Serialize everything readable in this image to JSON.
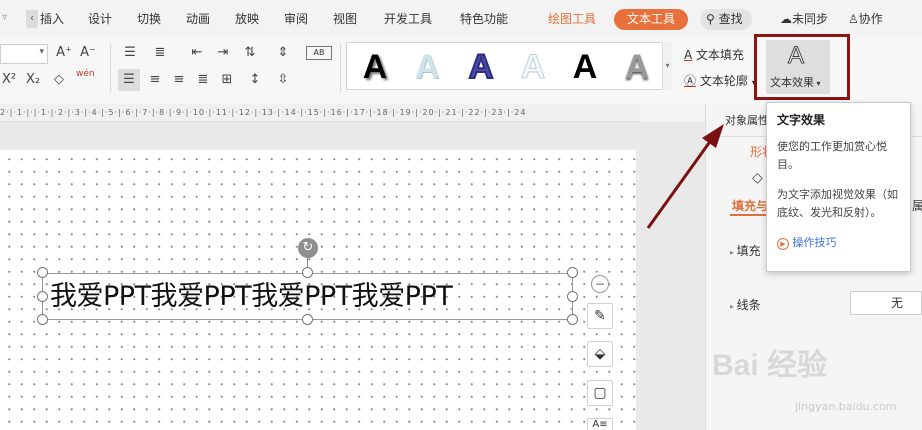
{
  "tabs": {
    "insert": "插入",
    "design": "设计",
    "transition": "切换",
    "animation": "动画",
    "slideshow": "放映",
    "review": "审阅",
    "view": "视图",
    "developer": "开发工具",
    "special": "特色功能",
    "drawing_tools": "绘图工具",
    "text_tools": "文本工具"
  },
  "top_right": {
    "search": "查找",
    "unsync": "未同步",
    "collab": "协作"
  },
  "ribbon": {
    "text_fill": "文本填充",
    "text_outline": "文本轮廓",
    "text_effect": "文本效果",
    "wen_label": "wén",
    "ab_label": "AB",
    "wordart_glyph": "A"
  },
  "ruler_text": "2·|·1·|·|·1·|·2·|·3·|·4·|·5·|·6·|·7·|·8·|·9·|·10·|·11·|·12·|·13·|·14·|·15·|·16·|·17·|·18·|·19·|·20·|·21·|·22·|·23·|·24",
  "slide": {
    "textbox_text": "我爱PPT我爱PPT我爱PPT我爱PPT"
  },
  "pane": {
    "header_partial": "对象属性",
    "tab_shape": "形状",
    "fill_and_line_partial": "填充与",
    "attr_partial": "属性",
    "fill_label": "填充",
    "line_label": "线条",
    "line_value": "无"
  },
  "tooltip": {
    "title": "文字效果",
    "p1": "使您的工作更加赏心悦目。",
    "p2": "为文字添加视觉效果（如底纹、发光和反射）。",
    "link": "操作技巧"
  },
  "watermark": {
    "main": "Bai 经验",
    "url": "jingyan.baidu.com"
  },
  "colors": {
    "accent": "#e8703a",
    "highlight": "#8b1313",
    "link": "#3b6fd8"
  }
}
